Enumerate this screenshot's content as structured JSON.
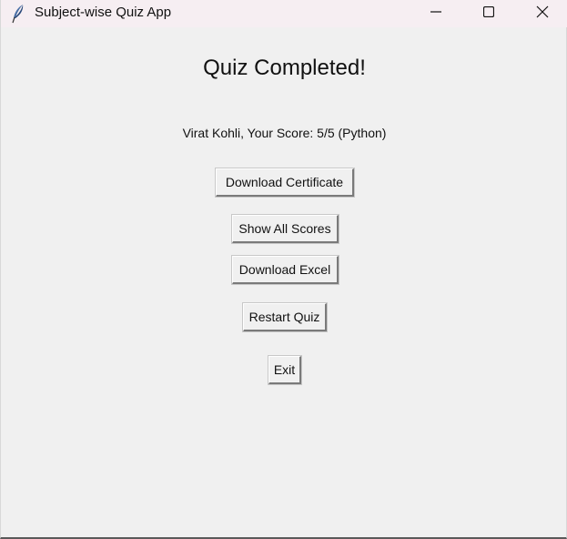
{
  "window": {
    "title": "Subject-wise Quiz App",
    "icon": "feather-icon",
    "controls": [
      "minimize-icon",
      "maximize-icon",
      "close-icon"
    ]
  },
  "main": {
    "heading": "Quiz Completed!",
    "score_text": "Virat Kohli, Your Score: 5/5 (Python)"
  },
  "buttons": {
    "download_certificate": "Download Certificate",
    "show_all_scores": "Show All Scores",
    "download_excel": "Download Excel",
    "restart_quiz": "Restart Quiz",
    "exit": "Exit"
  }
}
